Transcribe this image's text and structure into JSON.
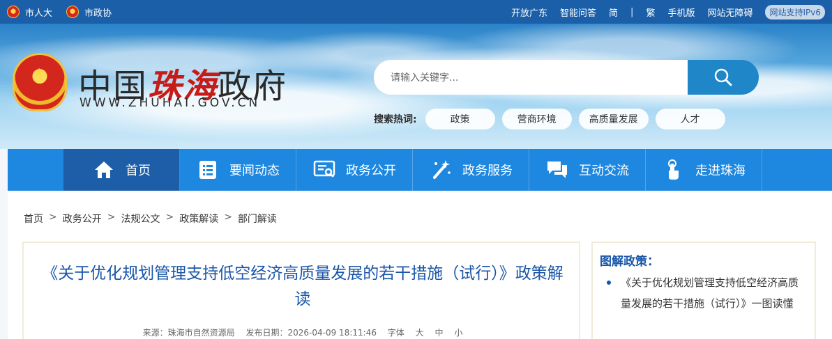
{
  "topbar": {
    "left": [
      {
        "label": "市人大",
        "icon": "emblem-icon"
      },
      {
        "label": "市政协",
        "icon": "emblem-icon"
      }
    ],
    "right": [
      "开放广东",
      "智能问答",
      "简",
      "|",
      "繁",
      "手机版",
      "网站无障碍"
    ],
    "ipv6": "网站支持IPv6"
  },
  "logo": {
    "title_pre": "中国",
    "title_city": "珠海",
    "title_post": "政府",
    "url": "WWW.ZHUHAI.GOV.CN"
  },
  "search": {
    "placeholder": "请输入关键字..."
  },
  "hot": {
    "label": "搜索热词:",
    "items": [
      "政策",
      "营商环境",
      "高质量发展",
      "人才"
    ]
  },
  "nav": {
    "items": [
      {
        "label": "首页",
        "icon": "home-icon"
      },
      {
        "label": "要闻动态",
        "icon": "news-list-icon"
      },
      {
        "label": "政务公开",
        "icon": "open-gov-icon"
      },
      {
        "label": "政务服务",
        "icon": "service-wand-icon"
      },
      {
        "label": "互动交流",
        "icon": "chat-bubbles-icon"
      },
      {
        "label": "走进珠海",
        "icon": "hand-tap-icon"
      }
    ]
  },
  "breadcrumb": [
    "首页",
    "政务公开",
    "法规公文",
    "政策解读",
    "部门解读"
  ],
  "article": {
    "title": "《关于优化规划管理支持低空经济高质量发展的若干措施（试行）》政策解读",
    "meta": {
      "source": "来源：珠海市自然资源局",
      "date": "发布日期：2026-04-09 18:11:46",
      "font_label": "字体",
      "font_sizes": [
        "大",
        "中",
        "小"
      ]
    }
  },
  "sidebar": {
    "head": "图解政策：",
    "items": [
      "《关于优化规划管理支持低空经济高质量发展的若干措施（试行）》一图读懂"
    ]
  },
  "colors": {
    "topbar": "#1a5fa7",
    "nav": "#1e87df",
    "nav_active": "#1e5ea8",
    "title_blue": "#1a56a8",
    "city_red": "#c81a16"
  }
}
